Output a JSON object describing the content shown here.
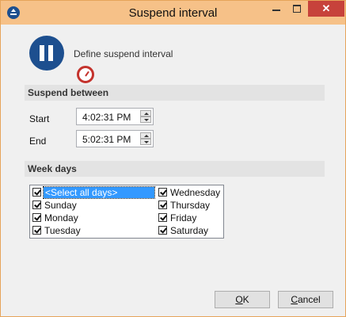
{
  "window": {
    "title": "Suspend interval",
    "close_glyph": "✕"
  },
  "header": {
    "text": "Define suspend interval",
    "icon": "pause-clock-icon"
  },
  "suspend": {
    "section_label": "Suspend between",
    "start_label": "Start",
    "start_value": "4:02:31 PM",
    "end_label": "End",
    "end_value": "5:02:31 PM"
  },
  "weekdays": {
    "section_label": "Week days",
    "items": [
      {
        "label": "<Select all days>",
        "checked": true,
        "selected": true
      },
      {
        "label": "Sunday",
        "checked": true
      },
      {
        "label": "Monday",
        "checked": true
      },
      {
        "label": "Tuesday",
        "checked": true
      },
      {
        "label": "Wednesday",
        "checked": true
      },
      {
        "label": "Thursday",
        "checked": true
      },
      {
        "label": "Friday",
        "checked": true
      },
      {
        "label": "Saturday",
        "checked": true
      }
    ]
  },
  "buttons": {
    "ok_mnemonic": "O",
    "ok_rest": "K",
    "cancel_mnemonic": "C",
    "cancel_rest": "ancel"
  },
  "colors": {
    "titlebar": "#f6c188",
    "close": "#c7423b",
    "selection": "#3399ff",
    "icon_blue": "#1d4f8f"
  }
}
